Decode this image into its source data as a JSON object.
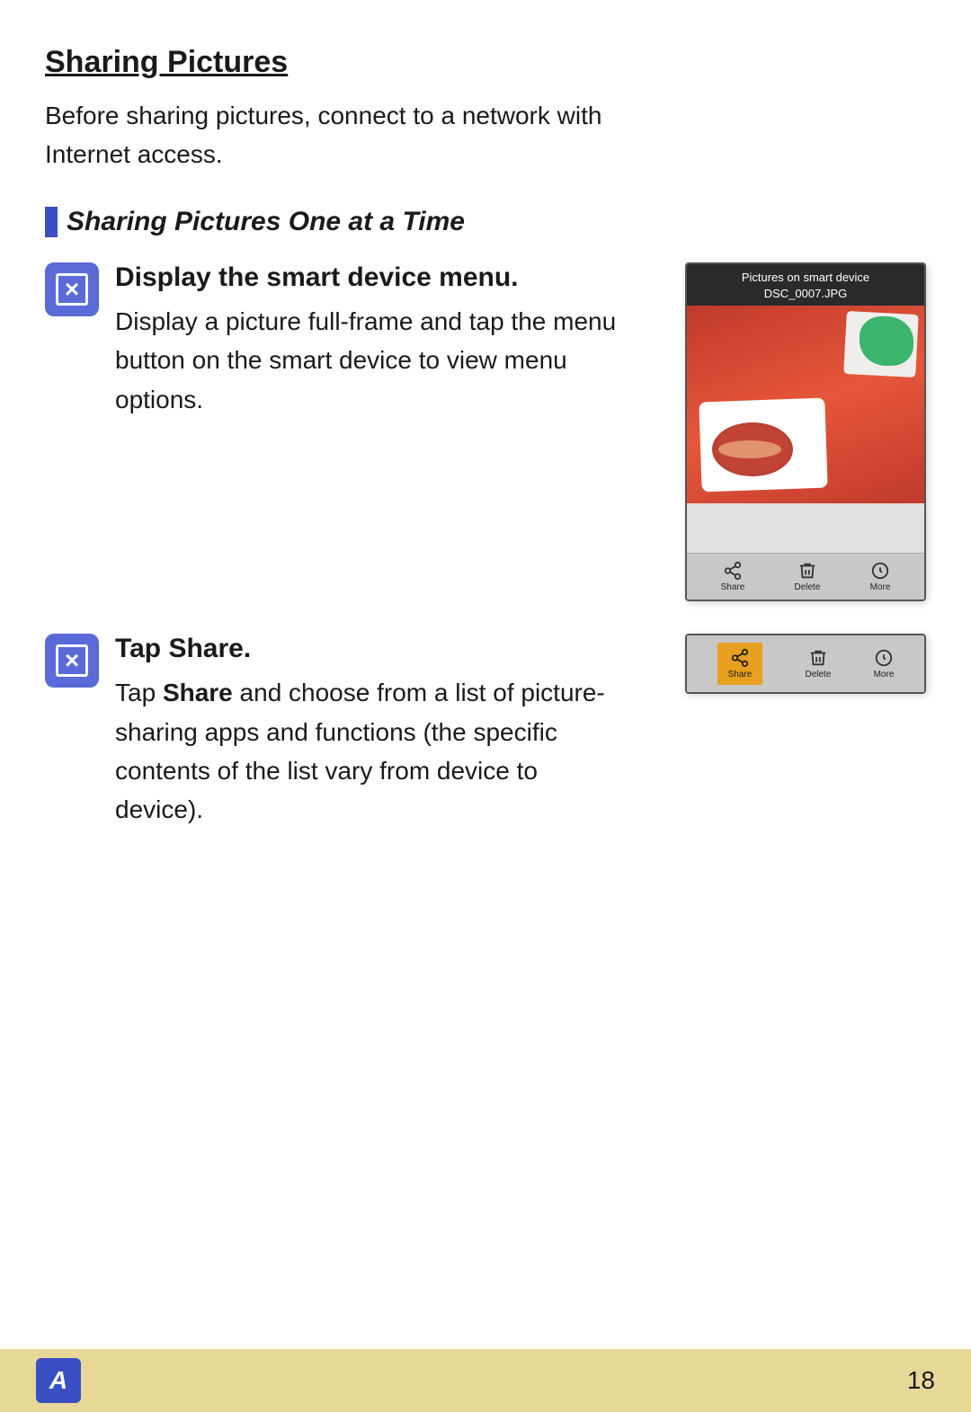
{
  "page": {
    "title": "Sharing Pictures",
    "intro": "Before sharing pictures, connect to a network with Internet access.",
    "section_heading": "Sharing Pictures One at a Time",
    "step1": {
      "title": "Display the smart device menu.",
      "body": "Display a picture full-frame and tap the menu button on the smart device to view menu options.",
      "phone_header_line1": "Pictures on smart device",
      "phone_header_line2": "DSC_0007.JPG",
      "action_share": "Share",
      "action_delete": "Delete",
      "action_more": "More"
    },
    "step2": {
      "title_prefix": "Tap ",
      "title_bold": "Share.",
      "body_prefix": "Tap ",
      "body_bold": "Share",
      "body_suffix": " and choose from a list of picture-sharing apps and functions (the specific contents of the list vary from device to device).",
      "action_share": "Share",
      "action_delete": "Delete",
      "action_more": "More"
    },
    "footer": {
      "logo_letter": "A",
      "page_number": "18"
    }
  }
}
